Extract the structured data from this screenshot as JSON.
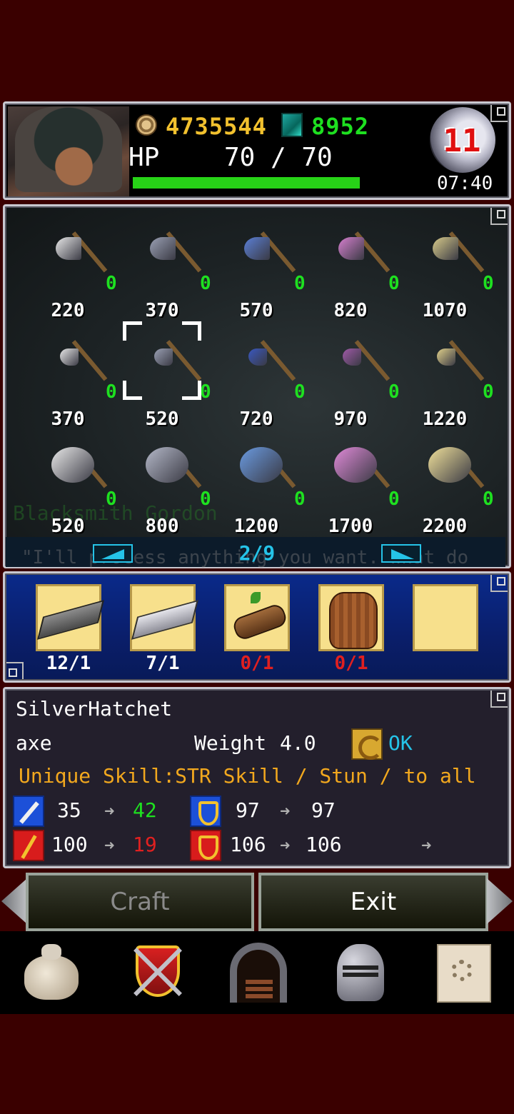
{
  "header": {
    "gold": "4735544",
    "gems": "8952",
    "hp_label": "HP",
    "hp_value": "70 / 70",
    "hp_fraction": 1.0,
    "day": "11",
    "time": "07:40"
  },
  "grid": {
    "background_text": [
      "Blacksmith Gordon",
      "\"I'll process anything you want. What do"
    ],
    "rows": [
      [
        {
          "price": "220",
          "count": "0",
          "color": "#e8e8e8"
        },
        {
          "price": "370",
          "count": "0",
          "color": "#9aa0b4"
        },
        {
          "price": "570",
          "count": "0",
          "color": "#5b7fd6"
        },
        {
          "price": "820",
          "count": "0",
          "color": "#d67fcf"
        },
        {
          "price": "1070",
          "count": "0",
          "color": "#d8cb8a"
        }
      ],
      [
        {
          "price": "370",
          "count": "0",
          "color": "#e8e8e8"
        },
        {
          "price": "520",
          "count": "0",
          "color": "#9aa0b4"
        },
        {
          "price": "720",
          "count": "0",
          "color": "#3a58c0"
        },
        {
          "price": "970",
          "count": "0",
          "color": "#a05aa8"
        },
        {
          "price": "1220",
          "count": "0",
          "color": "#e0d08a"
        }
      ],
      [
        {
          "price": "520",
          "count": "0",
          "color": "#e8e8e8"
        },
        {
          "price": "800",
          "count": "0",
          "color": "#b4b8c8"
        },
        {
          "price": "1200",
          "count": "0",
          "color": "#6a9ae0"
        },
        {
          "price": "1700",
          "count": "0",
          "color": "#e08ad8"
        },
        {
          "price": "2200",
          "count": "0",
          "color": "#f0e09a"
        }
      ]
    ],
    "page": "2/9"
  },
  "materials": [
    {
      "name": "iron-ingot",
      "label": "12/1",
      "ok": true
    },
    {
      "name": "silver-ingot",
      "label": "7/1",
      "ok": true
    },
    {
      "name": "wood-log",
      "label": "0/1",
      "ok": false
    },
    {
      "name": "leather-hide",
      "label": "0/1",
      "ok": false
    },
    {
      "name": "empty-slot",
      "label": "",
      "ok": true
    }
  ],
  "info": {
    "name": "SilverHatchet",
    "type": "axe",
    "weight_label": "Weight",
    "weight_value": "4.0",
    "requirement": "OK",
    "skill": "Unique Skill:STR Skill / Stun / to all",
    "stats": {
      "attack_from": "35",
      "attack_to": "42",
      "defense_from": "97",
      "defense_to": "97",
      "magic_from": "100",
      "magic_to": "19",
      "speed_from": "106",
      "speed_to": "106"
    }
  },
  "buttons": {
    "craft": "Craft",
    "exit": "Exit"
  },
  "nav": [
    "bag-icon",
    "battle-crest-icon",
    "dungeon-door-icon",
    "knight-helmet-icon",
    "map-scroll-icon"
  ],
  "colors": {
    "gold_text": "#f2c12e",
    "gem_text": "#1ee020",
    "count_green": "#1ee020",
    "increase_green": "#1ee020",
    "decrease_red": "#e02020",
    "skill_orange": "#f2a81e",
    "ok_cyan": "#25c3e8"
  }
}
